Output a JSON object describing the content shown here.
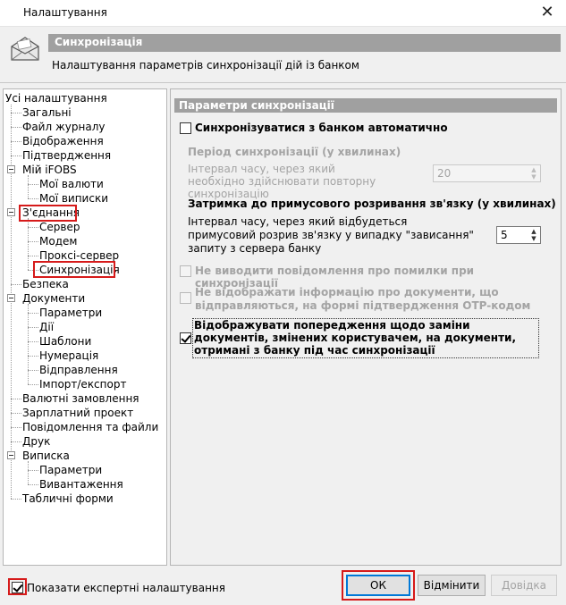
{
  "window": {
    "title": "Налаштування"
  },
  "header": {
    "section_title": "Синхронізація",
    "description": "Налаштування параметрів синхронізації дій із банком"
  },
  "tree": {
    "items": [
      {
        "label": "Усі налаштування"
      },
      {
        "label": "Загальні"
      },
      {
        "label": "Файл журналу"
      },
      {
        "label": "Відображення"
      },
      {
        "label": "Підтвердження"
      },
      {
        "label": "Мій iFOBS"
      },
      {
        "label": "Мої валюти"
      },
      {
        "label": "Мої виписки"
      },
      {
        "label": "З'єднання"
      },
      {
        "label": "Сервер"
      },
      {
        "label": "Модем"
      },
      {
        "label": "Проксі-сервер"
      },
      {
        "label": "Синхронізація"
      },
      {
        "label": "Безпека"
      },
      {
        "label": "Документи"
      },
      {
        "label": "Параметри"
      },
      {
        "label": "Дії"
      },
      {
        "label": "Шаблони"
      },
      {
        "label": "Нумерація"
      },
      {
        "label": "Відправлення"
      },
      {
        "label": "Імпорт/експорт"
      },
      {
        "label": "Валютні замовлення"
      },
      {
        "label": "Зарплатний проект"
      },
      {
        "label": "Повідомлення та файли"
      },
      {
        "label": "Друк"
      },
      {
        "label": "Виписка"
      },
      {
        "label": "Параметри"
      },
      {
        "label": "Вивантаження"
      },
      {
        "label": "Табличні форми"
      }
    ]
  },
  "panel": {
    "section_title": "Параметри синхронізації",
    "auto_sync_label": "Синхронізуватися з банком автоматично",
    "auto_sync_checked": false,
    "period_title": "Період синхронізації (у хвилинах)",
    "period_desc": "Інтервал часу, через який необхідно здійснювати повторну синхронізацію",
    "period_value": "20",
    "delay_title": "Затримка до примусового розривання зв'язку (у хвилинах)",
    "delay_desc": "Інтервал часу, через який відбудеться примусовий розрив зв'язку у випадку \"зависання\" запиту з сервера банку",
    "delay_value": "5",
    "no_errors_label": "Не виводити повідомлення про помилки при синхронізації",
    "no_info_label": "Не відображати інформацію про документи, що відправляються, на формі підтвердження OTP-кодом",
    "warn_replace_label": "Відображувати попередження щодо заміни документів, змінених користувачем, на документи, отримані з банку під час синхронізації",
    "warn_replace_checked": true
  },
  "footer": {
    "expert_label": "Показати експертні налаштування",
    "expert_checked": true,
    "ok_label": "ОК",
    "cancel_label": "Відмінити",
    "help_label": "Довідка"
  },
  "colors": {
    "band": "#a0a0a0",
    "highlight_red": "#d61a1a",
    "default_button_border": "#0078d7"
  }
}
